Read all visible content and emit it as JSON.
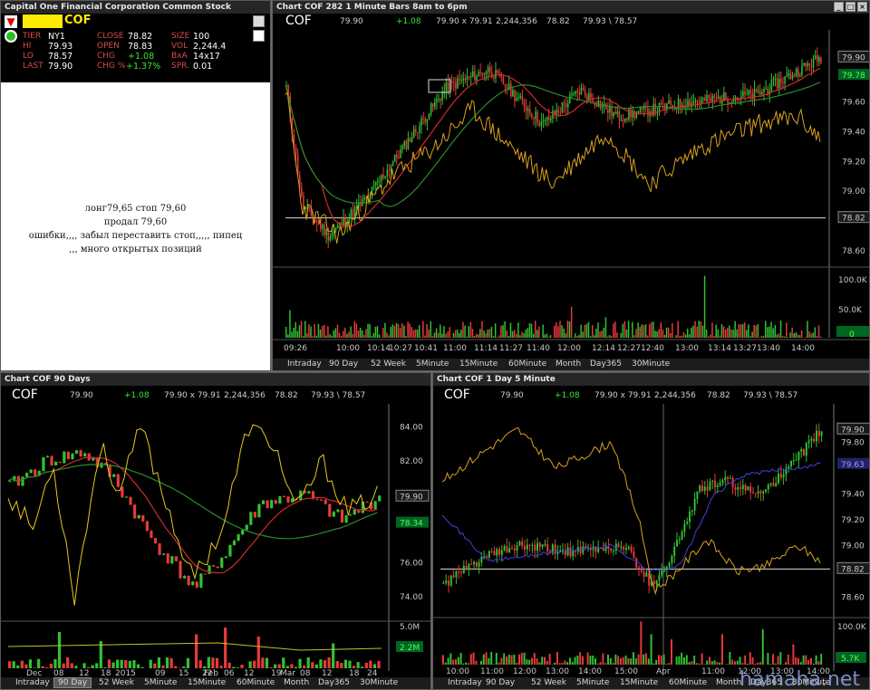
{
  "quote_window": {
    "title": "Capital One Financial Corporation Common Stock",
    "symbol": "COF",
    "fields": [
      {
        "k": "TIER",
        "v": "NY1"
      },
      {
        "k": "CLOSE",
        "v": "78.82"
      },
      {
        "k": "SIZE",
        "v": "100"
      },
      {
        "k": "HI",
        "v": "79.93"
      },
      {
        "k": "OPEN",
        "v": "78.83"
      },
      {
        "k": "VOL",
        "v": "2,244.4"
      },
      {
        "k": "LO",
        "v": "78.57"
      },
      {
        "k": "CHG",
        "v": "+1.08"
      },
      {
        "k": "BxA",
        "v": "14x17"
      },
      {
        "k": "LAST",
        "v": "79.90"
      },
      {
        "k": "CHG %",
        "v": "+1.37%"
      },
      {
        "k": "SPR.",
        "v": "0.01"
      }
    ],
    "notes": [
      "лонг79,65  стоп 79,60",
      "продал 79,60",
      "ошибки,,,, забыл переставить стоп,,,,, пипец",
      ",,, много открытых позиций"
    ]
  },
  "quote_line": {
    "symbol": "COF",
    "last": "79.90",
    "chg": "+1.08",
    "bidask": "79.90 x 79.91",
    "vol": "2,244,356",
    "close": "78.82",
    "hilo": "79.93 \\ 78.57"
  },
  "chart1": {
    "title": "Chart COF 282 1 Minute Bars 8am to 6pm",
    "y_ticks": [
      "79.90",
      "79.78",
      "79.60",
      "79.40",
      "79.20",
      "79.00",
      "78.82",
      "78.60"
    ],
    "vol_ticks": [
      "100.0K",
      "50.0K",
      "0"
    ],
    "x_ticks": [
      "09:26",
      "10:00",
      "10:14",
      "10:27",
      "10:41",
      "11:00",
      "11:14",
      "11:27",
      "11:40",
      "12:00",
      "12:14",
      "12:27",
      "12:40",
      "13:00",
      "13:14",
      "13:27",
      "13:40",
      "14:00"
    ],
    "tabs": [
      "Intraday",
      "90 Day",
      "52 Week",
      "5Minute",
      "15Minute",
      "60Minute",
      "Month",
      "Day365",
      "30Minute"
    ]
  },
  "chart2": {
    "title": "Chart COF 90 Days",
    "y_ticks": [
      "84.00",
      "82.00",
      "79.90",
      "78.34",
      "76.00",
      "74.00"
    ],
    "vol_ticks": [
      "5.0M",
      "2.2M"
    ],
    "x_ticks": [
      "Dec",
      "08",
      "12",
      "18",
      "2015",
      "09",
      "15",
      "22",
      "Feb",
      "06",
      "12",
      "19",
      "Mar",
      "08",
      "12",
      "18",
      "24",
      "Apr"
    ],
    "tabs": [
      "Intraday",
      "90 Day",
      "52 Week",
      "5Minute",
      "15Minute",
      "60Minute",
      "Month",
      "Day365",
      "30Minute"
    ]
  },
  "chart3": {
    "title": "Chart COF 1 Day 5 Minute",
    "y_ticks": [
      "79.90",
      "79.80",
      "79.63",
      "79.40",
      "79.20",
      "79.00",
      "78.82",
      "78.60"
    ],
    "vol_ticks": [
      "100.0K",
      "5.7K"
    ],
    "x_ticks": [
      "10:00",
      "11:00",
      "12:00",
      "13:00",
      "14:00",
      "15:00",
      "Apr",
      "11:00",
      "12:00",
      "13:00",
      "14:00"
    ],
    "tabs": [
      "Intraday",
      "90 Day",
      "52 Week",
      "5Minute",
      "15Minute",
      "60Minute",
      "Month",
      "Day365",
      "30Minute"
    ]
  },
  "watermark": "hamaha.net",
  "colors": {
    "up": "#31c231",
    "down": "#e83a3a",
    "ma_red": "#d42a2a",
    "ma_green": "#2a8c2a",
    "osc": "#d9a020",
    "osc2": "#e6c81e",
    "ma_blue": "#4040e0"
  }
}
